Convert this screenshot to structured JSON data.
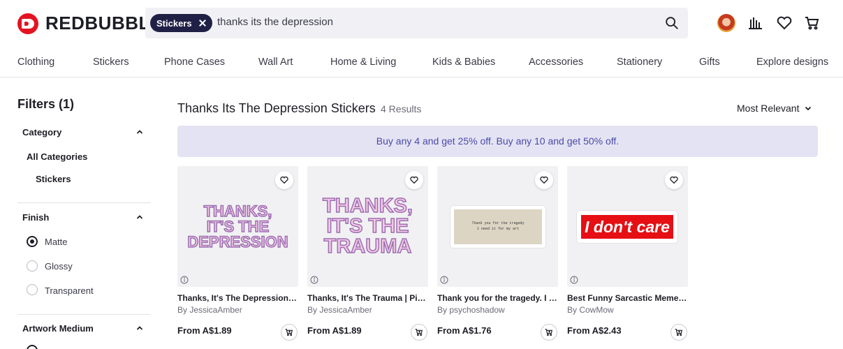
{
  "brand": {
    "name": "REDBUBBLE",
    "color": "#e41321"
  },
  "search": {
    "chip_label": "Stickers",
    "query": "thanks its the depression"
  },
  "header_icons": [
    "avatar",
    "stats-icon",
    "heart-icon",
    "cart-icon"
  ],
  "nav": [
    "Clothing",
    "Stickers",
    "Phone Cases",
    "Wall Art",
    "Home & Living",
    "Kids & Babies",
    "Accessories",
    "Stationery",
    "Gifts",
    "Explore designs"
  ],
  "filters": {
    "title": "Filters (1)",
    "category": {
      "title": "Category",
      "items": [
        "All Categories",
        "Stickers"
      ]
    },
    "finish": {
      "title": "Finish",
      "options": [
        "Matte",
        "Glossy",
        "Transparent"
      ],
      "selected": "Matte"
    },
    "artwork_medium": {
      "title": "Artwork Medium"
    }
  },
  "results": {
    "title": "Thanks Its The Depression Stickers",
    "count": "4 Results",
    "sort": "Most Relevant",
    "promo": "Buy any 4 and get 25% off.  Buy any 10 and get 50% off."
  },
  "products": [
    {
      "title": "Thanks, It's The Depression | Pink Sticker",
      "artist": "By JessicaAmber",
      "price": "From A$1.89",
      "art": [
        "THANKS,",
        "IT'S THE",
        "DEPRESSION"
      ]
    },
    {
      "title": "Thanks, It's The Trauma | Pink Sticker",
      "artist": "By JessicaAmber",
      "price": "From A$1.89",
      "art": [
        "THANKS,",
        "IT'S THE",
        "TRAUMA"
      ]
    },
    {
      "title": "Thank you for the tragedy. I need it for my art",
      "artist": "By psychoshadow",
      "price": "From A$1.76",
      "art": [
        "Thank you for the tragedy",
        "I need it for my art"
      ]
    },
    {
      "title": "Best Funny Sarcastic Meme Sticker",
      "artist": "By CowMow",
      "price": "From A$2.43",
      "art": [
        "I don't care"
      ]
    }
  ],
  "colors": {
    "chip_bg": "#202047",
    "promo_bg": "#e4e3f3",
    "promo_text": "#4b4aa8",
    "sticker_red": "#e50f14"
  }
}
